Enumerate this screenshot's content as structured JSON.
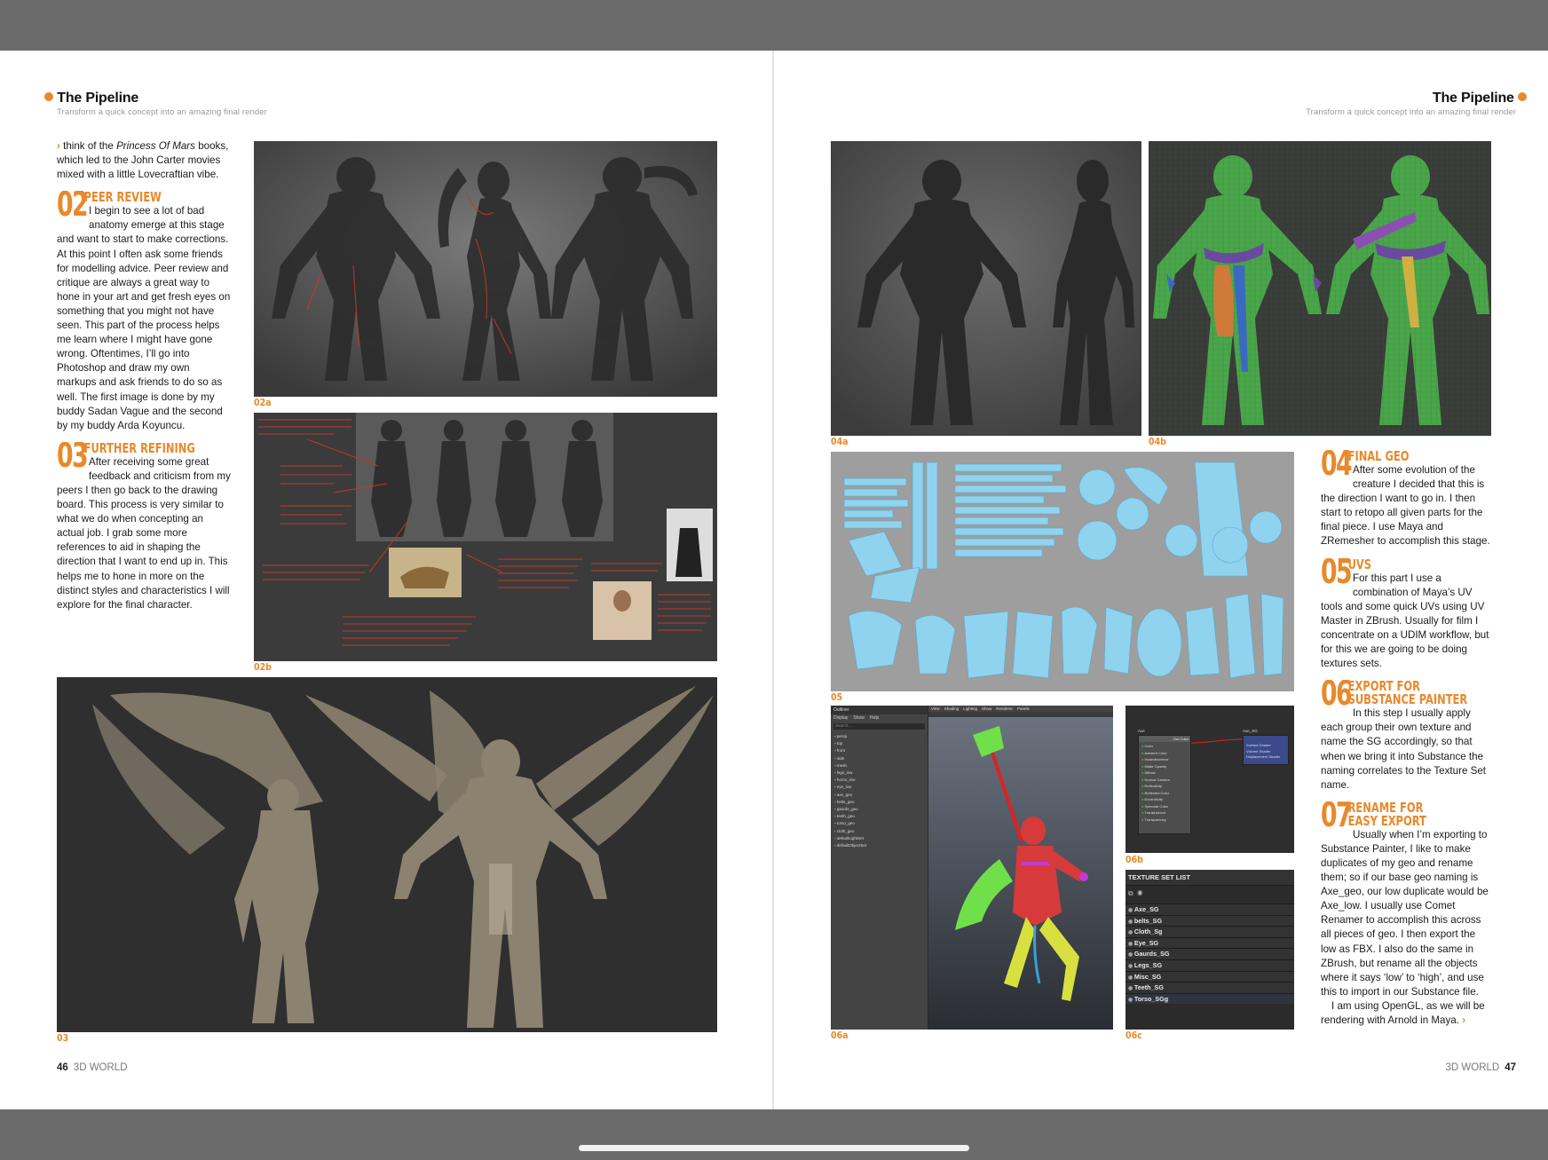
{
  "header": {
    "title": "The Pipeline",
    "subtitle": "Transform a quick concept into an amazing final render"
  },
  "left": {
    "intro_prefix": "think of the ",
    "intro_em": "Princess Of Mars",
    "intro_rest": " books, which led to the John Carter movies mixed with a little Lovecraftian vibe.",
    "steps": [
      {
        "num": "02",
        "title": "Peer review",
        "text": "I begin to see a lot of bad anatomy emerge at this stage and want to start to make corrections. At this point I often ask some friends for modelling advice. Peer review and critique are always a great way to hone in your art and get fresh eyes on something that you might not have seen. This part of the process helps me learn where I might have gone wrong. Oftentimes, I’ll go into Photoshop and draw my own markups and ask friends to do so as well. The first image is done by my buddy Sadan Vague and the second by my buddy Arda Koyuncu."
      },
      {
        "num": "03",
        "title": "Further refining",
        "text": "After receiving some great feedback and criticism from my peers I then go back to the drawing board. This process is very similar to what we do when concepting an actual job. I grab some more references to aid in shaping the direction that I want to end up in. This helps me to hone in more on the distinct styles and characteristics I will explore for the final character."
      }
    ],
    "captions": {
      "c02a": "02a",
      "c02b": "02b",
      "c03": "03"
    },
    "folio": {
      "num": "46",
      "mag": "3D WORLD"
    }
  },
  "right": {
    "steps": [
      {
        "num": "04",
        "title": "Final geo",
        "title2": "",
        "text": "After some evolution of the creature I decided that this is the direction I want to go in. I then start to retopo all given parts for the final piece. I use Maya and ZRemesher to accomplish this stage."
      },
      {
        "num": "05",
        "title": "UVs",
        "title2": "",
        "text": "For this part I use a combination of Maya’s UV tools and some quick UVs using UV Master in ZBrush. Usually for film I concentrate on a UDIM workflow, but for this we are going to be doing textures sets."
      },
      {
        "num": "06",
        "title": "Export for",
        "title2": "Substance Painter",
        "text": "In this step I usually apply each group their own texture and name the SG accordingly, so that when we bring it into Substance the naming correlates to the Texture Set name."
      },
      {
        "num": "07",
        "title": "Rename for",
        "title2": "easy export",
        "text": "Usually when I’m exporting to Substance Painter, I like to make duplicates of my geo and rename them; so if our base geo naming is Axe_geo, our low duplicate would be Axe_low. I usually use Comet Renamer to accomplish this across all pieces of geo. I then export the low as FBX. I also do the same in ZBrush, but rename all the objects where it says ‘low’ to ‘high’, and use this to import in our Substance file.",
        "text2": "I am using OpenGL, as we will be rendering with Arnold in Maya."
      }
    ],
    "captions": {
      "c04a": "04a",
      "c04b": "04b",
      "c05": "05",
      "c06a": "06a",
      "c06b": "06b",
      "c06c": "06c"
    },
    "texture_set_list": {
      "title": "TEXTURE SET LIST",
      "items": [
        "Axe_SG",
        "belts_SG",
        "Cloth_Sg",
        "Eye_SG",
        "Gaurds_SG",
        "Legs_SG",
        "Misc_SG",
        "Teeth_SG",
        "Torso_SGg"
      ]
    },
    "maya_outliner": {
      "title": "Outliner",
      "menu": [
        "Display",
        "Show",
        "Help"
      ],
      "search": "Search...",
      "items": [
        "persp",
        "top",
        "front",
        "side",
        "mesh",
        "legs_low",
        "horns_low",
        "eye_low",
        "axe_geo",
        "belts_geo",
        "gaurds_geo",
        "teeth_geo",
        "torso_geo",
        "cloth_geo",
        "defaultLightSet",
        "defaultObjectSet"
      ]
    },
    "maya_viewport_menu": [
      "View",
      "Shading",
      "Lighting",
      "Show",
      "Renderer",
      "Panels"
    ],
    "hypershade": {
      "node1": "Axe",
      "node2": "Axe_SG",
      "node1_header": "Out Color",
      "node1_attrs": [
        "Color",
        "Ambient Color",
        "Incandescence",
        "Matte Opacity",
        "Diffuse",
        "Normal Camera",
        "Reflectivity",
        "Reflected Color",
        "Eccentricity",
        "Specular Color",
        "Translucence",
        "Transparency"
      ],
      "node2_attrs": [
        "Surface Shader",
        "Volume Shader",
        "Displacement Shader"
      ]
    },
    "folio": {
      "num": "47",
      "mag": "3D WORLD"
    }
  },
  "colors": {
    "accent": "#e8892b",
    "uv_blue": "#8fd3ef",
    "uv_bg": "#9e9e9e"
  }
}
